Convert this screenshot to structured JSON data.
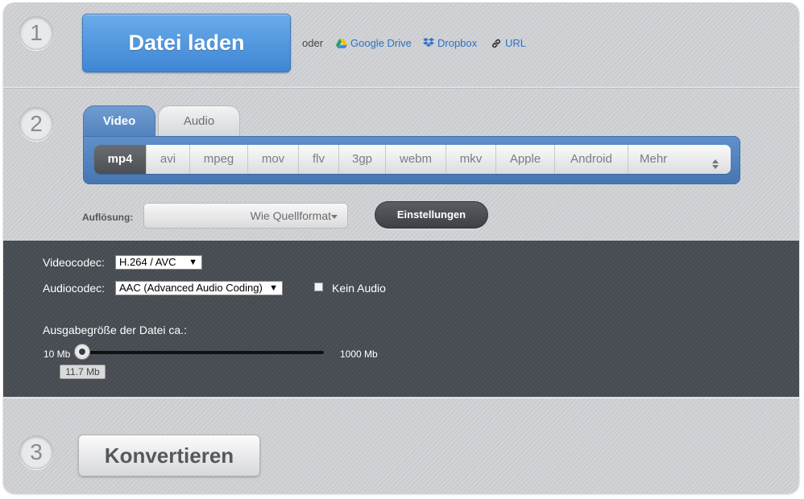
{
  "step1": {
    "number": "1",
    "load_button": "Datei laden",
    "or_text": "oder",
    "links": [
      {
        "label": "Google Drive",
        "icon": "google-drive-icon"
      },
      {
        "label": "Dropbox",
        "icon": "dropbox-icon"
      },
      {
        "label": "URL",
        "icon": "link-icon"
      }
    ]
  },
  "step2": {
    "number": "2",
    "tabs": [
      {
        "label": "Video",
        "active": true
      },
      {
        "label": "Audio",
        "active": false
      }
    ],
    "formats": [
      "mp4",
      "avi",
      "mpeg",
      "mov",
      "flv",
      "3gp",
      "webm",
      "mkv",
      "Apple",
      "Android"
    ],
    "active_format": "mp4",
    "more_label": "Mehr",
    "resolution_label": "Auflösung:",
    "resolution_value": "Wie Quellformat",
    "settings_button": "Einstellungen"
  },
  "settings": {
    "video_codec_label": "Videocodec:",
    "video_codec_value": "H.264 / AVC",
    "audio_codec_label": "Audiocodec:",
    "audio_codec_value": "AAC (Advanced Audio Coding)",
    "no_audio_label": "Kein Audio",
    "no_audio_checked": false,
    "file_size_label": "Ausgabegröße der Datei ca.:",
    "slider_min": "10 Mb",
    "slider_max": "1000 Mb",
    "slider_value": "11.7 Mb"
  },
  "step3": {
    "number": "3",
    "convert_button": "Konvertieren"
  },
  "colors": {
    "accent_blue": "#4a8fdc",
    "tab_blue": "#5b8ac6",
    "link_blue": "#2d72c4",
    "dark_panel": "#4a4e55"
  }
}
